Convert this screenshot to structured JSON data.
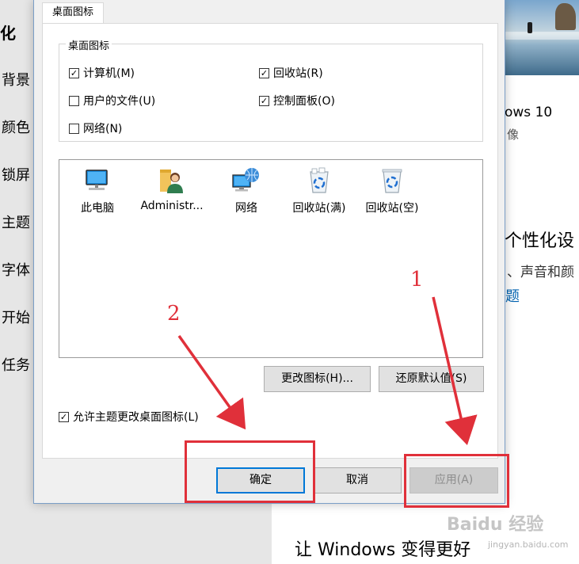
{
  "background": {
    "nav_heading": "化",
    "nav_items": [
      "背景",
      "颜色",
      "锁屏",
      "主题",
      "字体",
      "开始",
      "任务"
    ],
    "theme_name": "ows 10",
    "theme_sub": "像",
    "section_heading": "个性化设",
    "section_desc": "、声音和颜",
    "section_link": "题",
    "bottom_heading": "让 Windows 变得更好",
    "watermark": "Baidu 经验",
    "watermark_sub": "jingyan.baidu.com"
  },
  "dialog": {
    "tab_label": "桌面图标",
    "group_title": "桌面图标",
    "checkboxes": [
      {
        "label": "计算机(M)",
        "checked": true
      },
      {
        "label": "回收站(R)",
        "checked": true
      },
      {
        "label": "用户的文件(U)",
        "checked": false
      },
      {
        "label": "控制面板(O)",
        "checked": true
      },
      {
        "label": "网络(N)",
        "checked": false
      }
    ],
    "icons": [
      {
        "label": "此电脑",
        "icon": "computer-icon"
      },
      {
        "label": "Administr...",
        "icon": "user-folder-icon"
      },
      {
        "label": "网络",
        "icon": "network-icon"
      },
      {
        "label": "回收站(满)",
        "icon": "recycle-bin-full-icon"
      },
      {
        "label": "回收站(空)",
        "icon": "recycle-bin-empty-icon"
      }
    ],
    "change_icon_button": "更改图标(H)...",
    "restore_default_button": "还原默认值(S)",
    "allow_themes_checkbox": {
      "label": "允许主题更改桌面图标(L)",
      "checked": true
    },
    "ok_button": "确定",
    "cancel_button": "取消",
    "apply_button": "应用(A)"
  },
  "annotations": {
    "label_1": "1",
    "label_2": "2",
    "color": "#e0303a"
  }
}
